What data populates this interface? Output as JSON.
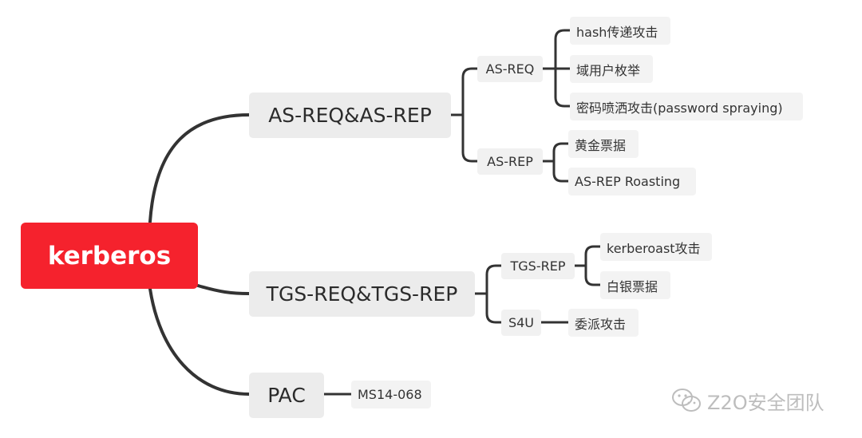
{
  "diagram": {
    "root": "kerberos",
    "branches": {
      "asreq_asrep": {
        "label": "AS-REQ&AS-REP",
        "as_req": {
          "label": "AS-REQ",
          "items": [
            "hash传递攻击",
            "域用户枚举",
            "密码喷洒攻击(password spraying)"
          ]
        },
        "as_rep": {
          "label": "AS-REP",
          "items": [
            "黄金票据",
            "AS-REP Roasting"
          ]
        }
      },
      "tgsreq_tgsrep": {
        "label": "TGS-REQ&TGS-REP",
        "tgs_rep": {
          "label": "TGS-REP",
          "items": [
            "kerberoast攻击",
            "白银票据"
          ]
        },
        "s4u": {
          "label": "S4U",
          "items": [
            "委派攻击"
          ]
        }
      },
      "pac": {
        "label": "PAC",
        "items": [
          "MS14-068"
        ]
      }
    },
    "line_color": "#333333",
    "root_color": "#f5222d"
  },
  "watermark": {
    "text": "Z2O安全团队",
    "icon": "wechat-icon"
  }
}
